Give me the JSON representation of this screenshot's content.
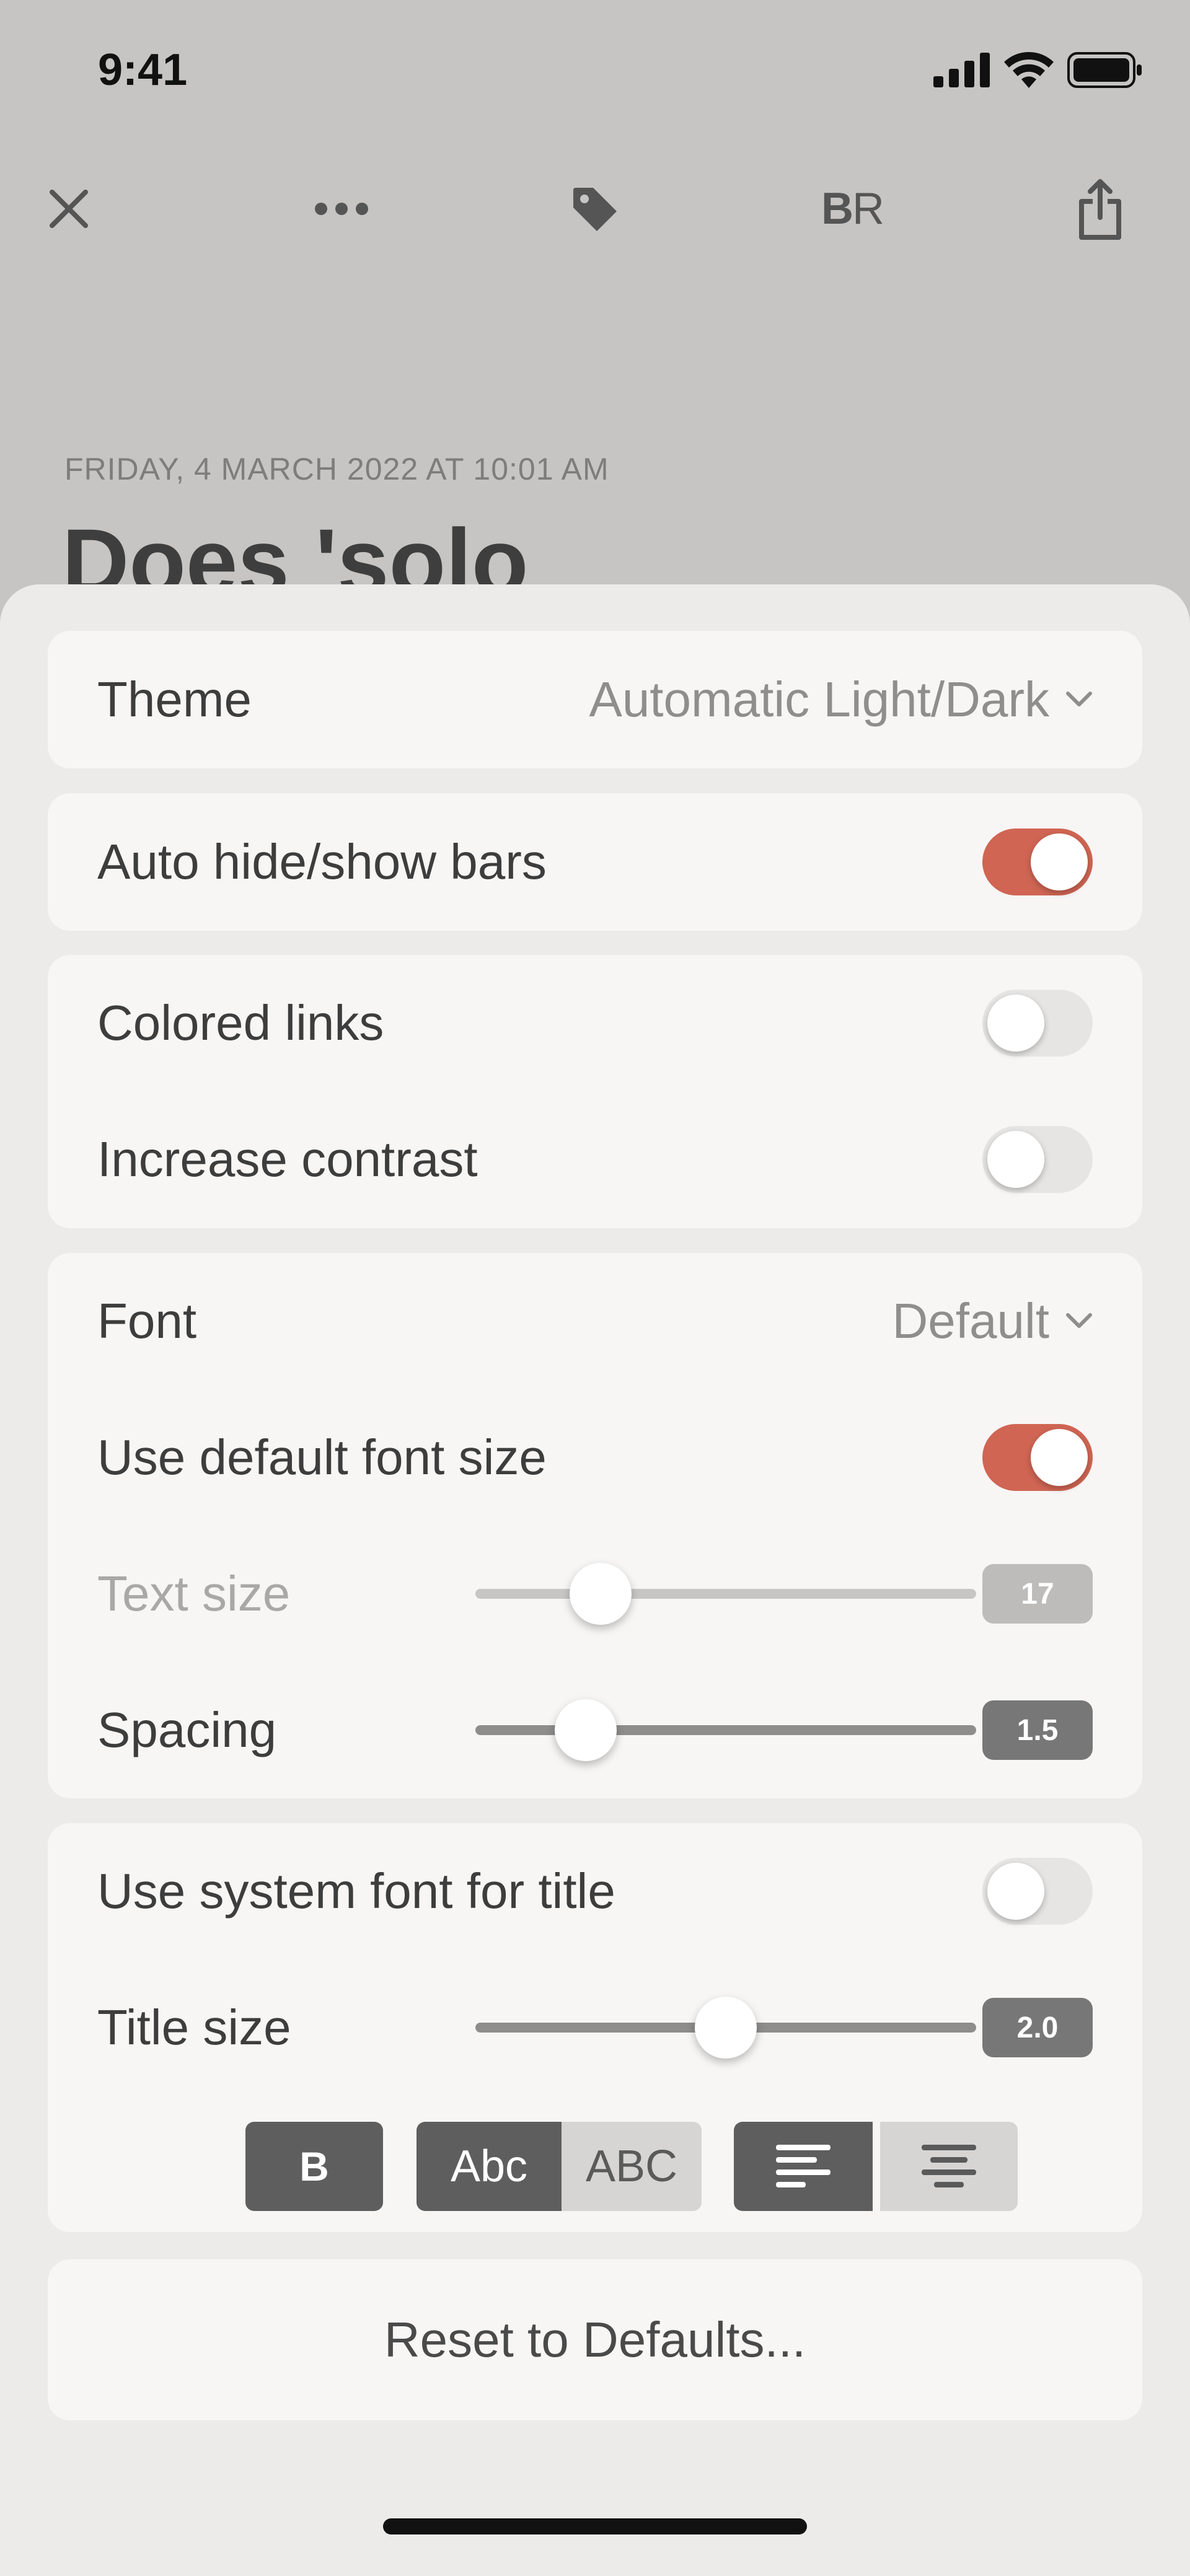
{
  "status_bar": {
    "time": "9:41"
  },
  "toolbar": {
    "close_icon": "close-icon",
    "more_icon": "more-icon",
    "tag_icon": "tag-icon",
    "br_label_bold": "B",
    "br_label_regular": "R",
    "share_icon": "share-icon"
  },
  "article": {
    "date": "FRIDAY, 4 MARCH 2022 AT 10:01 AM",
    "title": "Does 'solo"
  },
  "settings": {
    "theme": {
      "label": "Theme",
      "value": "Automatic Light/Dark"
    },
    "auto_hide": {
      "label": "Auto hide/show bars",
      "on": true
    },
    "colored_links": {
      "label": "Colored links",
      "on": false
    },
    "increase_contrast": {
      "label": "Increase contrast",
      "on": false
    },
    "font": {
      "label": "Font",
      "value": "Default"
    },
    "default_font_size": {
      "label": "Use default font size",
      "on": true
    },
    "text_size": {
      "label": "Text size",
      "value": "17",
      "level": 0.25
    },
    "spacing": {
      "label": "Spacing",
      "value": "1.5",
      "level": 0.22
    },
    "system_font_title": {
      "label": "Use system font for title",
      "on": false
    },
    "title_size": {
      "label": "Title size",
      "value": "2.0",
      "level": 0.5
    },
    "format_buttons": {
      "bold": "B",
      "title_case": "Abc",
      "upper_case": "ABC"
    },
    "reset": "Reset to Defaults..."
  },
  "colors": {
    "accent": "#d06553",
    "card": "#f7f6f5",
    "sheet": "#ecebea"
  }
}
